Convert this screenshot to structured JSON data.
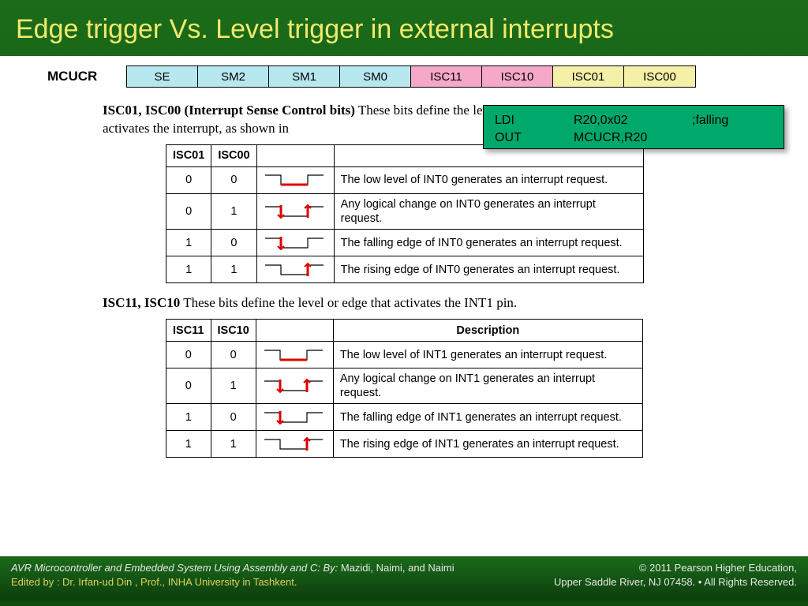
{
  "title": "Edge trigger Vs. Level trigger in external interrupts",
  "register": {
    "label": "MCUCR",
    "bits": [
      {
        "name": "SE",
        "color": "cyan"
      },
      {
        "name": "SM2",
        "color": "cyan"
      },
      {
        "name": "SM1",
        "color": "cyan"
      },
      {
        "name": "SM0",
        "color": "cyan"
      },
      {
        "name": "ISC11",
        "color": "pink"
      },
      {
        "name": "ISC10",
        "color": "pink"
      },
      {
        "name": "ISC01",
        "color": "yellow"
      },
      {
        "name": "ISC00",
        "color": "yellow"
      }
    ]
  },
  "para1_bold": "ISC01, ISC00 (Interrupt Sense Control bits)",
  "para1_rest": "  These bits define the level or edge on the external INT0 pin that activates the interrupt, as shown in",
  "para2_bold": "ISC11, ISC10",
  "para2_rest": "  These bits define the level or edge that activates the INT1 pin.",
  "code": {
    "l1": {
      "op": "LDI",
      "args": "R20,0x02",
      "cmt": ";falling"
    },
    "l2": {
      "op": "OUT",
      "args": "MCUCR,R20",
      "cmt": ""
    }
  },
  "table1": {
    "h0": "ISC01",
    "h1": "ISC00",
    "h2": "",
    "h3": "",
    "rows": [
      {
        "a": "0",
        "b": "0",
        "wave": "low",
        "desc": "The low level of INT0 generates an interrupt request."
      },
      {
        "a": "0",
        "b": "1",
        "wave": "both",
        "desc": "Any logical change on INT0 generates an interrupt request."
      },
      {
        "a": "1",
        "b": "0",
        "wave": "fall",
        "desc": "The falling edge of INT0 generates an interrupt request."
      },
      {
        "a": "1",
        "b": "1",
        "wave": "rise",
        "desc": "The rising edge of INT0 generates an interrupt request."
      }
    ]
  },
  "table2": {
    "h0": "ISC11",
    "h1": "ISC10",
    "h2": "",
    "h3": "Description",
    "rows": [
      {
        "a": "0",
        "b": "0",
        "wave": "low",
        "desc": "The low level of INT1 generates an interrupt request."
      },
      {
        "a": "0",
        "b": "1",
        "wave": "both",
        "desc": "Any logical change on INT1 generates an interrupt request."
      },
      {
        "a": "1",
        "b": "0",
        "wave": "fall",
        "desc": "The falling edge of INT1 generates an interrupt request."
      },
      {
        "a": "1",
        "b": "1",
        "wave": "rise",
        "desc": "The rising edge of INT1 generates an interrupt request."
      }
    ]
  },
  "footer": {
    "book": "AVR Microcontroller and Embedded System Using Assembly and C:  By:",
    "authors": " Mazidi, Naimi, and Naimi",
    "editor": "Edited  by :  Dr. Irfan-ud Din , Prof., INHA University in Tashkent.",
    "r1": "© 2011   Pearson Higher Education,",
    "r2": "Upper Saddle River, NJ 07458. • All Rights Reserved."
  }
}
